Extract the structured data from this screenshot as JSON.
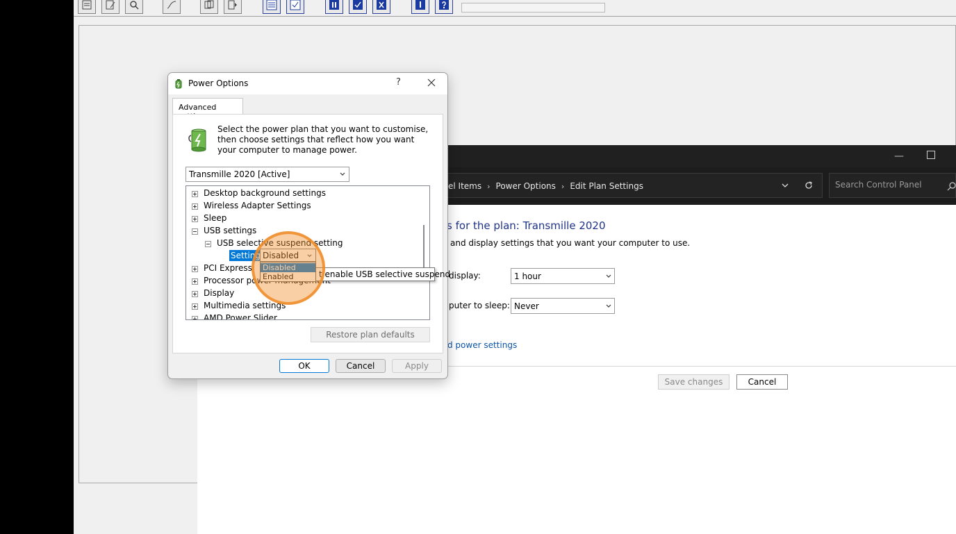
{
  "legacy_app": {
    "toolbar_icons": [
      "form-icon",
      "edit-form-icon",
      "magnify-icon",
      "curve-icon",
      "copy-page-icon",
      "next-page-icon",
      "list-icon",
      "checklist-icon",
      "pause-icon",
      "check-icon",
      "close-x-icon",
      "info-icon",
      "help-icon"
    ]
  },
  "control_panel": {
    "breadcrumb": [
      "el Items",
      "Power Options",
      "Edit Plan Settings"
    ],
    "search_placeholder": "Search Control Panel",
    "heading": "ngs for the plan: Transmille 2020",
    "subheading": "and display settings that you want your computer to use.",
    "turn_off_display_label": "display:",
    "turn_off_display_value": "1 hour",
    "sleep_label": "puter to sleep:",
    "sleep_value": "Never",
    "advanced_link": "d power settings",
    "save_button": "Save changes",
    "cancel_button": "Cancel"
  },
  "dialog": {
    "title": "Power Options",
    "help_glyph": "?",
    "tab": "Advanced settings",
    "intro": "Select the power plan that you want to customise, then choose settings that reflect how you want your computer to manage power.",
    "plan": "Transmille 2020 [Active]",
    "tree": [
      {
        "label": "Desktop background settings",
        "state": "collapsed"
      },
      {
        "label": "Wireless Adapter Settings",
        "state": "collapsed"
      },
      {
        "label": "Sleep",
        "state": "collapsed"
      },
      {
        "label": "USB settings",
        "state": "expanded"
      },
      {
        "label": "USB selective suspend setting",
        "state": "expanded"
      },
      {
        "label": "Setting",
        "state": "selected"
      },
      {
        "label": "PCI Express",
        "state": "collapsed"
      },
      {
        "label": "Processor power management",
        "state": "collapsed"
      },
      {
        "label": "Display",
        "state": "collapsed"
      },
      {
        "label": "Multimedia settings",
        "state": "collapsed"
      },
      {
        "label": "AMD Power Slider",
        "state": "collapsed"
      }
    ],
    "setting_combo": {
      "value": "Disabled",
      "options": [
        "Disabled",
        "Enabled"
      ]
    },
    "tooltip": "t enable USB selective suspend",
    "restore_button": "Restore plan defaults",
    "ok_button": "OK",
    "cancel_button": "Cancel",
    "apply_button": "Apply"
  },
  "colors": {
    "accent": "#0078d7",
    "link": "#0a55a8",
    "heading": "#1e3287",
    "highlight": "#f08c28"
  }
}
